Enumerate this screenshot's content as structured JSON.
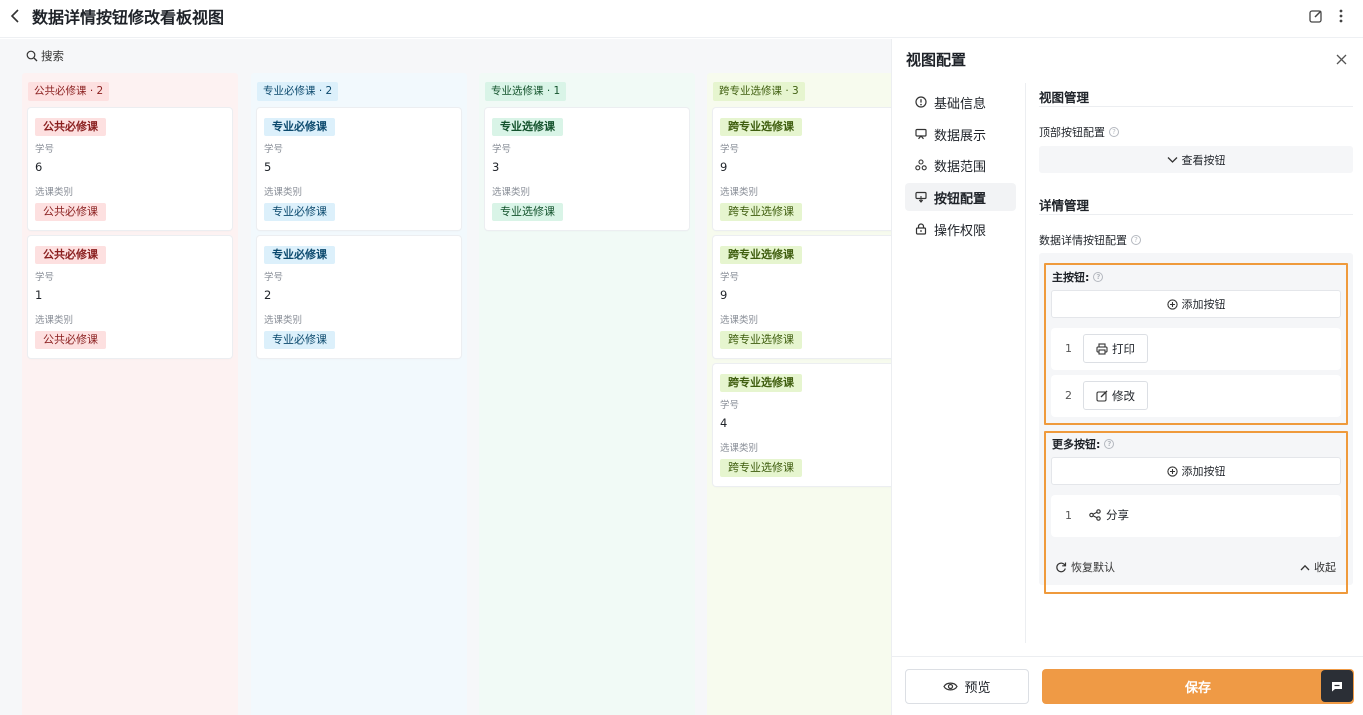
{
  "header": {
    "title": "数据详情按钮修改看板视图"
  },
  "kanban": {
    "search_label": "搜索",
    "field_labels": {
      "student_no": "学号",
      "course_type": "选课类别"
    },
    "columns": [
      {
        "header": "公共必修课 · 2",
        "bg": "#fdf2f2",
        "tag_bg": "#fde0e0",
        "tag_color": "#8a1f1f",
        "cards": [
          {
            "tag": "公共必修课",
            "student_no": "6",
            "course_type": "公共必修课"
          },
          {
            "tag": "公共必修课",
            "student_no": "1",
            "course_type": "公共必修课"
          }
        ]
      },
      {
        "header": "专业必修课 · 2",
        "bg": "#f2f9fd",
        "tag_bg": "#dcf0fb",
        "tag_color": "#0c4a6e",
        "cards": [
          {
            "tag": "专业必修课",
            "student_no": "5",
            "course_type": "专业必修课"
          },
          {
            "tag": "专业必修课",
            "student_no": "2",
            "course_type": "专业必修课"
          }
        ]
      },
      {
        "header": "专业选修课 · 1",
        "bg": "#f1faf6",
        "tag_bg": "#d9f4e7",
        "tag_color": "#14532d",
        "cards": [
          {
            "tag": "专业选修课",
            "student_no": "3",
            "course_type": "专业选修课"
          }
        ]
      },
      {
        "header": "跨专业选修课 · 3",
        "bg": "#f7fbee",
        "tag_bg": "#e6f5cf",
        "tag_color": "#3f5e0f",
        "cards": [
          {
            "tag": "跨专业选修课",
            "student_no": "9",
            "course_type": "跨专业选修课"
          },
          {
            "tag": "跨专业选修课",
            "student_no": "9",
            "course_type": "跨专业选修课"
          },
          {
            "tag": "跨专业选修课",
            "student_no": "4",
            "course_type": "跨专业选修课"
          }
        ]
      }
    ]
  },
  "panel": {
    "title": "视图配置",
    "nav": [
      {
        "label": "基础信息",
        "icon": "info-icon"
      },
      {
        "label": "数据展示",
        "icon": "display-icon"
      },
      {
        "label": "数据范围",
        "icon": "scope-icon"
      },
      {
        "label": "按钮配置",
        "icon": "button-config-icon",
        "active": true
      },
      {
        "label": "操作权限",
        "icon": "lock-icon"
      }
    ],
    "view_mgmt": {
      "title": "视图管理",
      "top_btn_label": "顶部按钮配置",
      "view_btn": "查看按钮"
    },
    "detail_mgmt": {
      "title": "详情管理",
      "detail_btn_label": "数据详情按钮配置",
      "main_label": "主按钮:",
      "add_btn": "添加按钮",
      "main_buttons": [
        {
          "index": "1",
          "label": "打印",
          "icon": "print-icon"
        },
        {
          "index": "2",
          "label": "修改",
          "icon": "edit-icon"
        }
      ],
      "more_label": "更多按钮:",
      "more_buttons": [
        {
          "index": "1",
          "label": "分享",
          "icon": "share-icon"
        }
      ],
      "restore": "恢复默认",
      "collapse": "收起"
    },
    "footer": {
      "preview": "预览",
      "save": "保存"
    },
    "colors": {
      "accent": "#ef9a45",
      "highlight_border": "#ef9a3c"
    }
  }
}
